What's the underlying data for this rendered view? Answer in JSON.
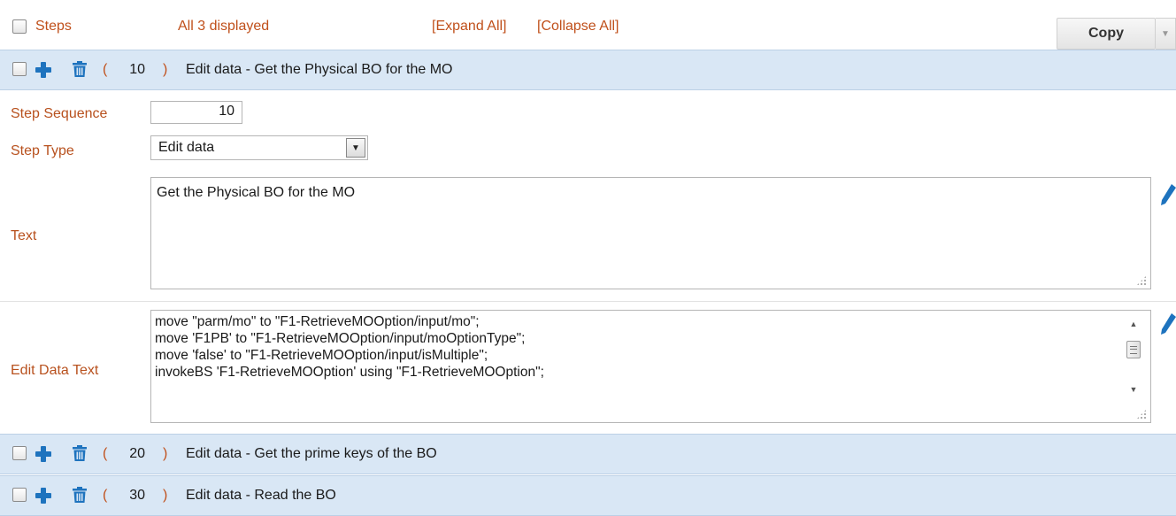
{
  "header": {
    "steps_label": "Steps",
    "count_text": "All 3 displayed",
    "expand_all": "[Expand All]",
    "collapse_all": "[Collapse All]",
    "copy_label": "Copy"
  },
  "steps": [
    {
      "sequence": "10",
      "summary": "Edit data - Get the Physical BO for the MO",
      "expanded": true,
      "fields": {
        "sequence_label": "Step Sequence",
        "sequence_value": "10",
        "type_label": "Step Type",
        "type_value": "Edit data",
        "text_label": "Text",
        "text_value": "Get the Physical BO for the MO",
        "edit_data_label": "Edit Data Text",
        "edit_data_lines": [
          "move \"parm/mo\" to \"F1-RetrieveMOOption/input/mo\";",
          "move 'F1PB' to \"F1-RetrieveMOOption/input/moOptionType\";",
          "move 'false' to \"F1-RetrieveMOOption/input/isMultiple\";",
          "invokeBS 'F1-RetrieveMOOption' using \"F1-RetrieveMOOption\";"
        ]
      }
    },
    {
      "sequence": "20",
      "summary": "Edit data - Get the prime keys of the BO",
      "expanded": false
    },
    {
      "sequence": "30",
      "summary": "Edit data - Read the BO",
      "expanded": false
    }
  ],
  "colors": {
    "label": "#b8511e",
    "band": "#d9e7f5",
    "icon_blue": "#1e73be"
  }
}
